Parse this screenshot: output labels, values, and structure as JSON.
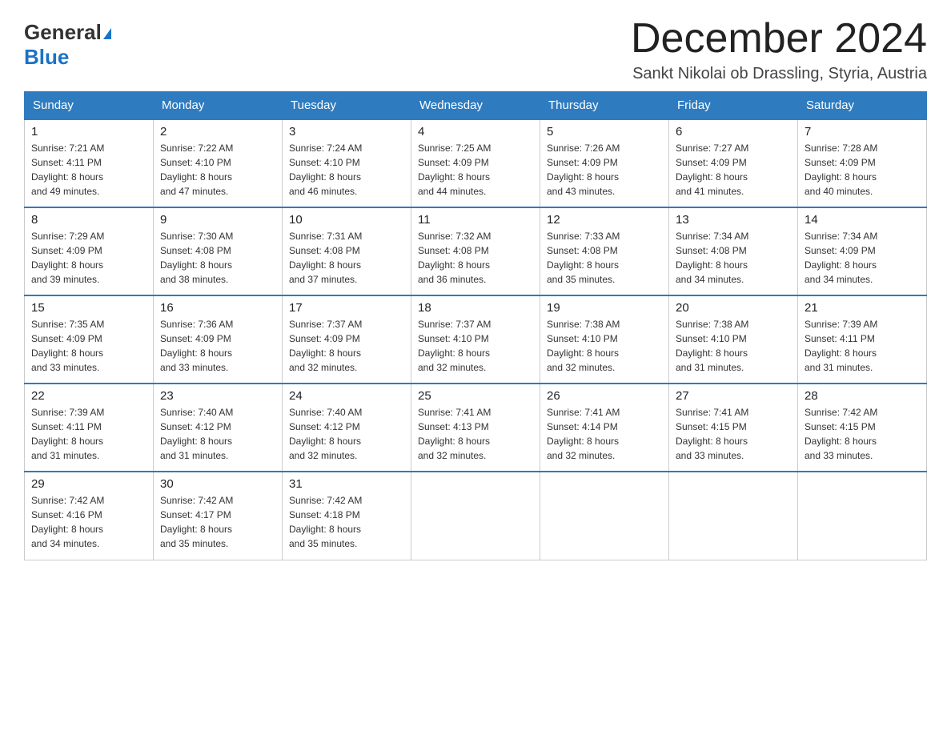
{
  "logo": {
    "general": "General",
    "blue": "Blue"
  },
  "header": {
    "title": "December 2024",
    "subtitle": "Sankt Nikolai ob Drassling, Styria, Austria"
  },
  "days_of_week": [
    "Sunday",
    "Monday",
    "Tuesday",
    "Wednesday",
    "Thursday",
    "Friday",
    "Saturday"
  ],
  "weeks": [
    [
      {
        "day": "1",
        "sunrise": "7:21 AM",
        "sunset": "4:11 PM",
        "daylight": "8 hours and 49 minutes."
      },
      {
        "day": "2",
        "sunrise": "7:22 AM",
        "sunset": "4:10 PM",
        "daylight": "8 hours and 47 minutes."
      },
      {
        "day": "3",
        "sunrise": "7:24 AM",
        "sunset": "4:10 PM",
        "daylight": "8 hours and 46 minutes."
      },
      {
        "day": "4",
        "sunrise": "7:25 AM",
        "sunset": "4:09 PM",
        "daylight": "8 hours and 44 minutes."
      },
      {
        "day": "5",
        "sunrise": "7:26 AM",
        "sunset": "4:09 PM",
        "daylight": "8 hours and 43 minutes."
      },
      {
        "day": "6",
        "sunrise": "7:27 AM",
        "sunset": "4:09 PM",
        "daylight": "8 hours and 41 minutes."
      },
      {
        "day": "7",
        "sunrise": "7:28 AM",
        "sunset": "4:09 PM",
        "daylight": "8 hours and 40 minutes."
      }
    ],
    [
      {
        "day": "8",
        "sunrise": "7:29 AM",
        "sunset": "4:09 PM",
        "daylight": "8 hours and 39 minutes."
      },
      {
        "day": "9",
        "sunrise": "7:30 AM",
        "sunset": "4:08 PM",
        "daylight": "8 hours and 38 minutes."
      },
      {
        "day": "10",
        "sunrise": "7:31 AM",
        "sunset": "4:08 PM",
        "daylight": "8 hours and 37 minutes."
      },
      {
        "day": "11",
        "sunrise": "7:32 AM",
        "sunset": "4:08 PM",
        "daylight": "8 hours and 36 minutes."
      },
      {
        "day": "12",
        "sunrise": "7:33 AM",
        "sunset": "4:08 PM",
        "daylight": "8 hours and 35 minutes."
      },
      {
        "day": "13",
        "sunrise": "7:34 AM",
        "sunset": "4:08 PM",
        "daylight": "8 hours and 34 minutes."
      },
      {
        "day": "14",
        "sunrise": "7:34 AM",
        "sunset": "4:09 PM",
        "daylight": "8 hours and 34 minutes."
      }
    ],
    [
      {
        "day": "15",
        "sunrise": "7:35 AM",
        "sunset": "4:09 PM",
        "daylight": "8 hours and 33 minutes."
      },
      {
        "day": "16",
        "sunrise": "7:36 AM",
        "sunset": "4:09 PM",
        "daylight": "8 hours and 33 minutes."
      },
      {
        "day": "17",
        "sunrise": "7:37 AM",
        "sunset": "4:09 PM",
        "daylight": "8 hours and 32 minutes."
      },
      {
        "day": "18",
        "sunrise": "7:37 AM",
        "sunset": "4:10 PM",
        "daylight": "8 hours and 32 minutes."
      },
      {
        "day": "19",
        "sunrise": "7:38 AM",
        "sunset": "4:10 PM",
        "daylight": "8 hours and 32 minutes."
      },
      {
        "day": "20",
        "sunrise": "7:38 AM",
        "sunset": "4:10 PM",
        "daylight": "8 hours and 31 minutes."
      },
      {
        "day": "21",
        "sunrise": "7:39 AM",
        "sunset": "4:11 PM",
        "daylight": "8 hours and 31 minutes."
      }
    ],
    [
      {
        "day": "22",
        "sunrise": "7:39 AM",
        "sunset": "4:11 PM",
        "daylight": "8 hours and 31 minutes."
      },
      {
        "day": "23",
        "sunrise": "7:40 AM",
        "sunset": "4:12 PM",
        "daylight": "8 hours and 31 minutes."
      },
      {
        "day": "24",
        "sunrise": "7:40 AM",
        "sunset": "4:12 PM",
        "daylight": "8 hours and 32 minutes."
      },
      {
        "day": "25",
        "sunrise": "7:41 AM",
        "sunset": "4:13 PM",
        "daylight": "8 hours and 32 minutes."
      },
      {
        "day": "26",
        "sunrise": "7:41 AM",
        "sunset": "4:14 PM",
        "daylight": "8 hours and 32 minutes."
      },
      {
        "day": "27",
        "sunrise": "7:41 AM",
        "sunset": "4:15 PM",
        "daylight": "8 hours and 33 minutes."
      },
      {
        "day": "28",
        "sunrise": "7:42 AM",
        "sunset": "4:15 PM",
        "daylight": "8 hours and 33 minutes."
      }
    ],
    [
      {
        "day": "29",
        "sunrise": "7:42 AM",
        "sunset": "4:16 PM",
        "daylight": "8 hours and 34 minutes."
      },
      {
        "day": "30",
        "sunrise": "7:42 AM",
        "sunset": "4:17 PM",
        "daylight": "8 hours and 35 minutes."
      },
      {
        "day": "31",
        "sunrise": "7:42 AM",
        "sunset": "4:18 PM",
        "daylight": "8 hours and 35 minutes."
      },
      null,
      null,
      null,
      null
    ]
  ],
  "labels": {
    "sunrise_prefix": "Sunrise: ",
    "sunset_prefix": "Sunset: ",
    "daylight_prefix": "Daylight: "
  }
}
